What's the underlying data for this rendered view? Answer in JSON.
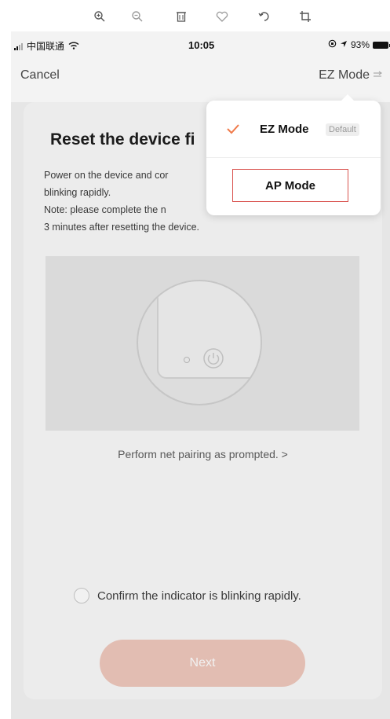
{
  "viewer_toolbar": {
    "icons": [
      "zoom-in-icon",
      "zoom-out-icon",
      "delete-icon",
      "favorite-icon",
      "rotate-icon",
      "crop-icon"
    ]
  },
  "status_bar": {
    "carrier": "中国联通",
    "time": "10:05",
    "battery": "93%"
  },
  "nav": {
    "cancel": "Cancel",
    "mode_toggle": "EZ Mode"
  },
  "card": {
    "title": "Reset the device fi",
    "desc_lines": [
      "Power on the device and cor",
      "blinking rapidly.",
      "Note: please complete the n",
      "3 minutes after resetting the device."
    ],
    "prompt_link": "Perform net pairing as prompted. >",
    "confirm_label": "Confirm the indicator is blinking rapidly.",
    "next_button": "Next"
  },
  "dropdown": {
    "ez_mode": "EZ Mode",
    "default_badge": "Default",
    "ap_mode": "AP Mode"
  },
  "colors": {
    "accent": "#f07a4a",
    "next_disabled": "#efc6b9",
    "highlight_border": "#d9534f"
  }
}
